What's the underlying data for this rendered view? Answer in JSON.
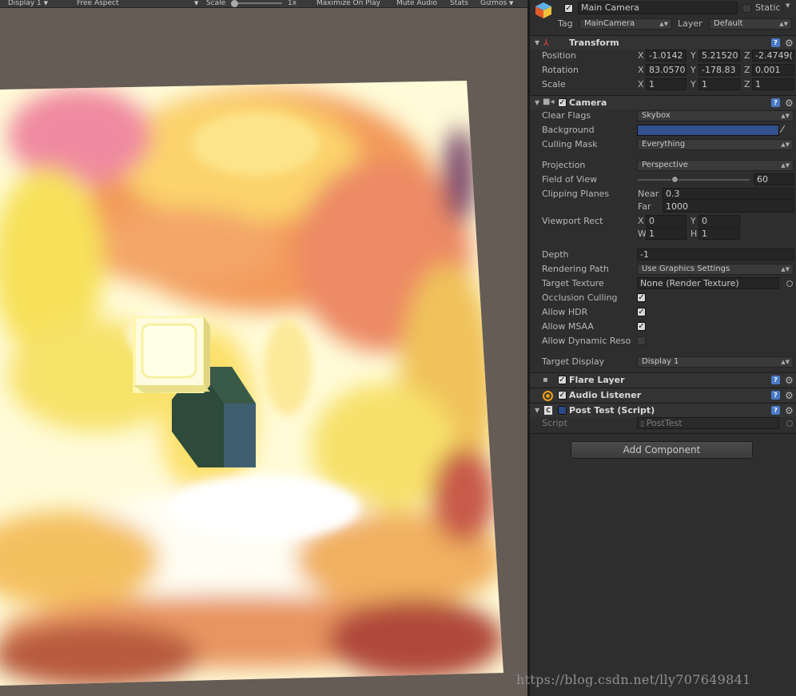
{
  "game_view": {
    "display": "Display 1",
    "aspect": "Free Aspect",
    "scale_label": "Scale",
    "scale_value": "1x",
    "maximize_on_play": "Maximize On Play",
    "mute_audio": "Mute Audio",
    "stats": "Stats",
    "gizmos": "Gizmos"
  },
  "header": {
    "object_name": "Main Camera",
    "static_label": "Static",
    "tag_label": "Tag",
    "tag_value": "MainCamera",
    "layer_label": "Layer",
    "layer_value": "Default"
  },
  "transform": {
    "title": "Transform",
    "position": {
      "label": "Position",
      "x": "-1.0142",
      "y": "5.21520",
      "z": "-2.4749("
    },
    "rotation": {
      "label": "Rotation",
      "x": "83.0570",
      "y": "-178.83",
      "z": "0.001"
    },
    "scale": {
      "label": "Scale",
      "x": "1",
      "y": "1",
      "z": "1"
    },
    "axis_x": "X",
    "axis_y": "Y",
    "axis_z": "Z"
  },
  "camera": {
    "title": "Camera",
    "clear_flags_label": "Clear Flags",
    "clear_flags": "Skybox",
    "background_label": "Background",
    "background_color": "#33508f",
    "culling_mask_label": "Culling Mask",
    "culling_mask": "Everything",
    "projection_label": "Projection",
    "projection": "Perspective",
    "fov_label": "Field of View",
    "fov": "60",
    "clipping_label": "Clipping Planes",
    "near_label": "Near",
    "near": "0.3",
    "far_label": "Far",
    "far": "1000",
    "viewport_label": "Viewport Rect",
    "vp_x_label": "X",
    "vp_x": "0",
    "vp_y_label": "Y",
    "vp_y": "0",
    "vp_w_label": "W",
    "vp_w": "1",
    "vp_h_label": "H",
    "vp_h": "1",
    "depth_label": "Depth",
    "depth": "-1",
    "rendering_path_label": "Rendering Path",
    "rendering_path": "Use Graphics Settings",
    "target_texture_label": "Target Texture",
    "target_texture": "None (Render Texture)",
    "occlusion_label": "Occlusion Culling",
    "hdr_label": "Allow HDR",
    "msaa_label": "Allow MSAA",
    "dynres_label": "Allow Dynamic Reso",
    "target_display_label": "Target Display",
    "target_display": "Display 1"
  },
  "components": {
    "flare_layer": "Flare Layer",
    "audio_listener": "Audio Listener",
    "post_test": "Post Test (Script)",
    "script_label": "Script",
    "script_value": "PostTest"
  },
  "add_component": "Add Component",
  "watermark": "https://blog.csdn.net/lly707649841",
  "colors": {
    "accent_blue": "#4a7ac7",
    "panel_bg": "#2e2e2e"
  }
}
